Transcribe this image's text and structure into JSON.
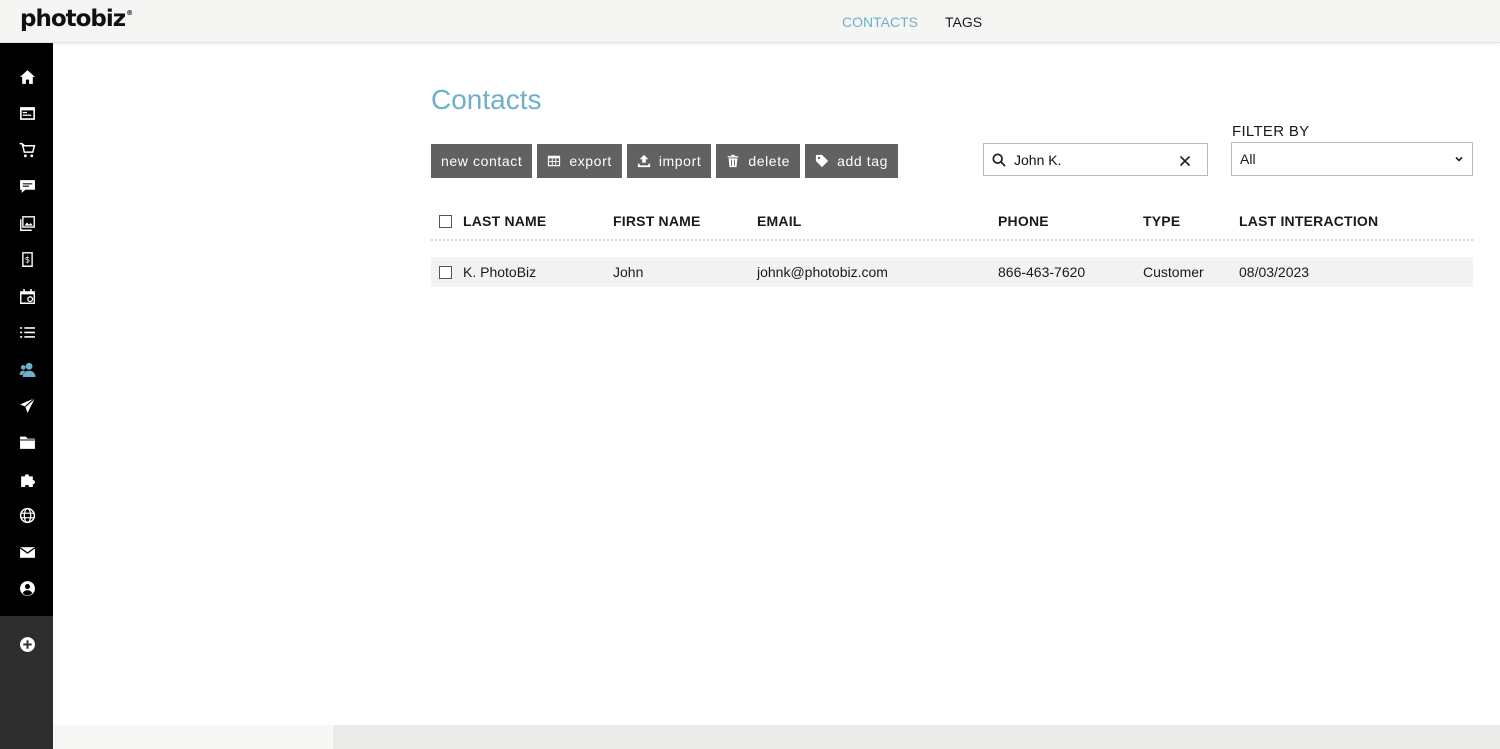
{
  "app": {
    "logo_text": "photobiz",
    "logo_mark": "®"
  },
  "topnav": {
    "contacts": "CONTACTS",
    "tags": "TAGS"
  },
  "sidebar": {
    "items": [
      {
        "icon": "home-icon"
      },
      {
        "icon": "website-icon"
      },
      {
        "icon": "cart-icon"
      },
      {
        "icon": "chat-icon"
      },
      {
        "icon": "gallery-icon"
      },
      {
        "icon": "invoice-icon"
      },
      {
        "icon": "calendar-icon"
      },
      {
        "icon": "list-icon"
      },
      {
        "icon": "contacts-icon",
        "active": true
      },
      {
        "icon": "send-icon"
      },
      {
        "icon": "folder-icon"
      },
      {
        "icon": "puzzle-icon"
      },
      {
        "icon": "globe-icon"
      },
      {
        "icon": "mail-icon"
      },
      {
        "icon": "account-icon"
      },
      {
        "icon": "add-circle-icon"
      }
    ],
    "active_color": "#6fb0c9"
  },
  "page": {
    "title": "Contacts"
  },
  "toolbar": {
    "new_contact": "new contact",
    "export": "export",
    "import": "import",
    "delete": "delete",
    "add_tag": "add tag"
  },
  "search": {
    "value": "John K."
  },
  "filter": {
    "label": "FILTER BY",
    "selected": "All"
  },
  "table": {
    "headers": {
      "last_name": "LAST NAME",
      "first_name": "FIRST NAME",
      "email": "EMAIL",
      "phone": "PHONE",
      "type": "TYPE",
      "last_interaction": "LAST INTERACTION"
    },
    "rows": [
      {
        "last_name": "K. PhotoBiz",
        "first_name": "John",
        "email": "johnk@photobiz.com",
        "phone": "866-463-7620",
        "type": "Customer",
        "last_interaction": "08/03/2023"
      }
    ]
  },
  "colors": {
    "accent": "#6fb0c9",
    "button_bg": "#616161",
    "sidebar_bg": "#000000"
  }
}
